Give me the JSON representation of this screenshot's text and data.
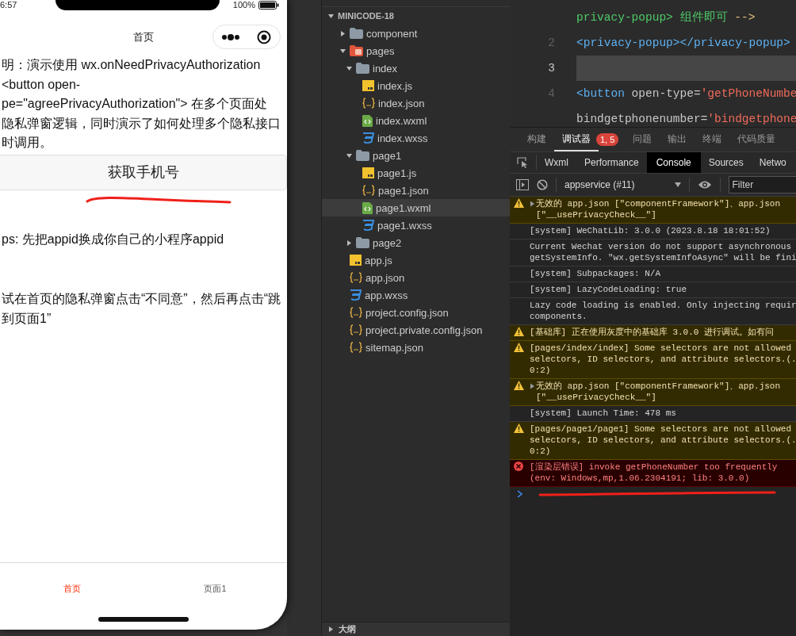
{
  "simulator": {
    "status_bar": {
      "time": "6:57",
      "battery": "100%"
    },
    "nav_title": "首页",
    "description_lines": [
      "明：演示使用 wx.onNeedPrivacyAuthorization",
      "<button open-",
      "pe=\"agreePrivacyAuthorization\"> 在多个页面处",
      "隐私弹窗逻辑，同时演示了如何处理多个隐私接口",
      "时调用。"
    ],
    "button": "获取手机号",
    "tips": "ps: 先把appid换成你自己的小程序appid",
    "hint_lines": [
      "试在首页的隐私弹窗点击“不同意”，然后再点击“跳",
      "到页面1”"
    ],
    "tabbar": [
      {
        "label": "首页",
        "selected": true
      },
      {
        "label": "页面1",
        "selected": false
      }
    ]
  },
  "explorer": {
    "root": {
      "label": "MINICODE-18",
      "expanded": true,
      "children": [
        {
          "label": "component",
          "kind": "folder",
          "expanded": false,
          "selected": false
        },
        {
          "label": "pages",
          "kind": "pages-folder",
          "expanded": true,
          "selected": false,
          "children": [
            {
              "label": "index",
              "kind": "folder",
              "expanded": true,
              "selected": false,
              "children": [
                {
                  "label": "index.js",
                  "kind": "js",
                  "selected": false
                },
                {
                  "label": "index.json",
                  "kind": "json",
                  "selected": false
                },
                {
                  "label": "index.wxml",
                  "kind": "wxml",
                  "selected": false
                },
                {
                  "label": "index.wxss",
                  "kind": "wxss",
                  "selected": false
                }
              ]
            },
            {
              "label": "page1",
              "kind": "folder",
              "expanded": true,
              "selected": false,
              "children": [
                {
                  "label": "page1.js",
                  "kind": "js",
                  "selected": false
                },
                {
                  "label": "page1.json",
                  "kind": "json",
                  "selected": false
                },
                {
                  "label": "page1.wxml",
                  "kind": "wxml",
                  "selected": true
                },
                {
                  "label": "page1.wxss",
                  "kind": "wxss",
                  "selected": false
                }
              ]
            },
            {
              "label": "page2",
              "kind": "folder",
              "expanded": false,
              "selected": false
            }
          ]
        },
        {
          "label": "app.js",
          "kind": "js",
          "selected": false
        },
        {
          "label": "app.json",
          "kind": "json",
          "selected": false
        },
        {
          "label": "app.wxss",
          "kind": "wxss",
          "selected": false
        },
        {
          "label": "project.config.json",
          "kind": "json",
          "selected": false
        },
        {
          "label": "project.private.config.json",
          "kind": "json",
          "selected": false
        },
        {
          "label": "sitemap.json",
          "kind": "json",
          "selected": false
        }
      ]
    },
    "outline": {
      "label": "大纲",
      "expanded": false
    }
  },
  "editor": {
    "lines": [
      {
        "current": false,
        "segments": [
          {
            "kind": "comment",
            "text": "privacy-popup> 组件即可 "
          },
          {
            "kind": "punct",
            "text": "-->"
          }
        ]
      },
      {
        "number": "2",
        "current": false,
        "segments": [
          {
            "kind": "tag",
            "text": "<privacy-popup></privacy-popup>"
          }
        ]
      },
      {
        "number": "3",
        "current": true
      },
      {
        "number": "4",
        "current": false,
        "segments": [
          {
            "kind": "tag",
            "text": "<button"
          },
          {
            "kind": "attr",
            "text": " open-type="
          },
          {
            "kind": "string",
            "text": "'getPhoneNumbe"
          }
        ]
      },
      {
        "current": false,
        "segments": [
          {
            "kind": "attr",
            "text": "bindgetphonenumber="
          },
          {
            "kind": "string",
            "text": "'bindgetphone"
          }
        ]
      }
    ]
  },
  "devtools": {
    "tabs": [
      {
        "label": "构建",
        "selected": false
      },
      {
        "label": "调试器",
        "selected": true,
        "badge": "1, 5"
      },
      {
        "label": "问题",
        "selected": false
      },
      {
        "label": "输出",
        "selected": false
      },
      {
        "label": "终端",
        "selected": false
      },
      {
        "label": "代码质量",
        "selected": false
      }
    ],
    "panels": [
      {
        "label": "Wxml",
        "selected": false
      },
      {
        "label": "Performance",
        "selected": false
      },
      {
        "label": "Console",
        "selected": true
      },
      {
        "label": "Sources",
        "selected": false
      },
      {
        "label": "Netwo",
        "selected": false
      }
    ],
    "context": "appservice (#11)",
    "filter": {
      "placeholder": "Filter"
    },
    "messages": [
      {
        "kind": "warn",
        "expandable": true,
        "text": "无效的 app.json [\"componentFramework\"]、app.json\n[\"__usePrivacyCheck__\"]"
      },
      {
        "kind": "log",
        "expandable": false,
        "text": "[system] WeChatLib: 3.0.0 (2023.8.18 18:01:52)"
      },
      {
        "kind": "log",
        "expandable": false,
        "text": "Current Wechat version do not support asynchronous\ngetSystemInfo. \"wx.getSystemInfoAsync\" will be fini"
      },
      {
        "kind": "log",
        "expandable": false,
        "text": "[system] Subpackages: N/A"
      },
      {
        "kind": "log",
        "expandable": false,
        "text": "[system] LazyCodeLoading: true"
      },
      {
        "kind": "log",
        "expandable": false,
        "text": "Lazy code loading is enabled. Only injecting requir\ncomponents."
      },
      {
        "kind": "warn",
        "expandable": false,
        "text": "[基础库] 正在使用灰度中的基础库 3.0.0 进行调试。如有问"
      },
      {
        "kind": "warn",
        "expandable": false,
        "text": "[pages/index/index] Some selectors are not allowed\nselectors, ID selectors, and attribute selectors.(.\n0:2)"
      },
      {
        "kind": "warn",
        "expandable": true,
        "text": "无效的 app.json [\"componentFramework\"]、app.json\n[\"__usePrivacyCheck__\"]"
      },
      {
        "kind": "log",
        "expandable": false,
        "text": "[system] Launch Time: 478 ms"
      },
      {
        "kind": "warn",
        "expandable": false,
        "text": "[pages/page1/page1] Some selectors are not allowed\nselectors, ID selectors, and attribute selectors.(.\n0:2)"
      },
      {
        "kind": "error",
        "expandable": false,
        "text": "[渲染层错误] invoke getPhoneNumber too frequently\n(env: Windows,mp,1.06.2304191; lib: 3.0.0)"
      }
    ]
  }
}
